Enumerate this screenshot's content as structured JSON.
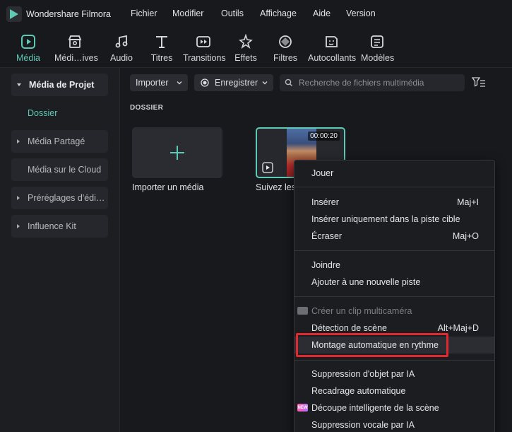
{
  "app": {
    "title": "Wondershare Filmora",
    "logo_icon": "filmora-logo-icon"
  },
  "menu": [
    "Fichier",
    "Modifier",
    "Outils",
    "Affichage",
    "Aide",
    "Version"
  ],
  "toolbar": [
    {
      "label": "Média",
      "icon": "media-icon",
      "active": true
    },
    {
      "label": "Médi…ives",
      "icon": "store-icon"
    },
    {
      "label": "Audio",
      "icon": "music-note-icon"
    },
    {
      "label": "Titres",
      "icon": "text-icon"
    },
    {
      "label": "Transitions",
      "icon": "transition-icon"
    },
    {
      "label": "Effets",
      "icon": "effects-icon"
    },
    {
      "label": "Filtres",
      "icon": "filter-icon"
    },
    {
      "label": "Autocollants",
      "icon": "sticker-icon"
    },
    {
      "label": "Modèles",
      "icon": "templates-icon"
    }
  ],
  "sidebar": {
    "items": [
      {
        "label": "Média de Projet",
        "expanded": true
      },
      {
        "label": "Média Partagé",
        "expanded": false
      },
      {
        "label": "Média sur le Cloud"
      },
      {
        "label": "Préréglages d'édi…",
        "expanded": false
      },
      {
        "label": "Influence Kit",
        "expanded": false
      }
    ],
    "sub_item": "Dossier"
  },
  "main": {
    "import_button": "Importer",
    "record_button": "Enregistrer",
    "search_placeholder": "Recherche de fichiers multimédia",
    "section_title": "DOSSIER",
    "import_card_label": "Importer un média",
    "clip": {
      "label": "Suivez les",
      "duration": "00:00:20"
    }
  },
  "context_menu": {
    "items": [
      {
        "label": "Jouer",
        "shortcut": ""
      },
      {
        "label": "Insérer",
        "shortcut": "Maj+I"
      },
      {
        "label": "Insérer uniquement dans la piste cible",
        "shortcut": ""
      },
      {
        "label": "Écraser",
        "shortcut": "Maj+O"
      },
      {
        "label": "Joindre",
        "shortcut": ""
      },
      {
        "label": "Ajouter à une nouvelle piste",
        "shortcut": ""
      },
      {
        "label": "Créer un clip multicaméra",
        "shortcut": "",
        "disabled": true
      },
      {
        "label": "Détection de scène",
        "shortcut": "Alt+Maj+D"
      },
      {
        "label": "Montage automatique en rythme",
        "shortcut": "",
        "highlighted": true
      },
      {
        "label": "Suppression d'objet par IA",
        "shortcut": ""
      },
      {
        "label": "Recadrage automatique",
        "shortcut": ""
      },
      {
        "label": "Découpe intelligente de la scène",
        "shortcut": "",
        "badge": "NEW"
      },
      {
        "label": "Suppression vocale par IA",
        "shortcut": ""
      }
    ]
  },
  "colors": {
    "accent": "#5ec9b5",
    "highlight_border": "#e0282e",
    "background": "#18191d"
  }
}
